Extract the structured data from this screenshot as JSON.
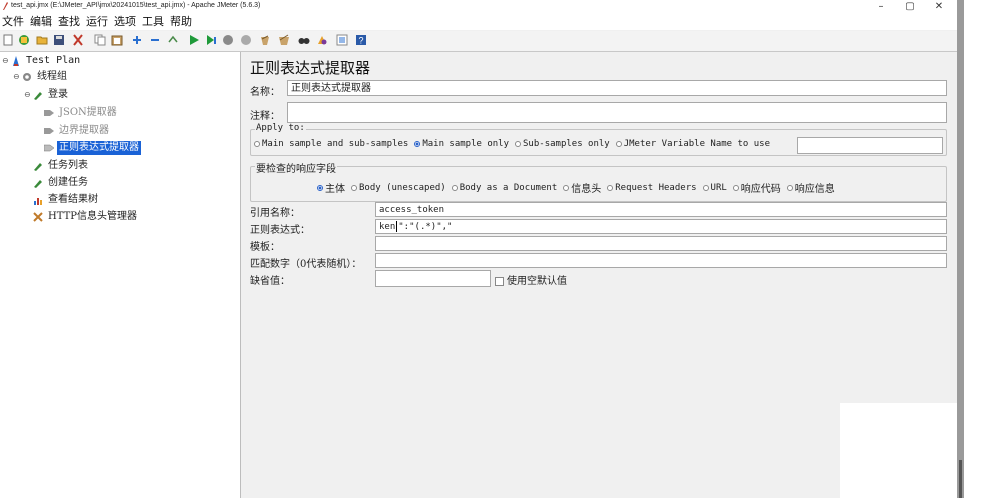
{
  "window": {
    "title": "test_api.jmx (E:\\JMeter_API\\jmx\\20241015\\test_api.jmx) - Apache JMeter (5.6.3)",
    "controls": [
      "–",
      "▢",
      "✕"
    ]
  },
  "menu": [
    "文件",
    "编辑",
    "查找",
    "运行",
    "选项",
    "工具",
    "帮助"
  ],
  "toolbar_icons": [
    "new-icon",
    "templates-icon",
    "open-icon",
    "save-icon",
    "cut-icon",
    "copy-icon",
    "paste-icon",
    "expand-icon",
    "collapse-icon",
    "toggle-icon",
    "start-icon",
    "start-no-pause-icon",
    "stop-icon",
    "shutdown-icon",
    "clear-icon",
    "clear-all-icon",
    "search-icon",
    "reset-search-icon",
    "function-helper-icon",
    "help-icon"
  ],
  "tree": {
    "test_plan": "Test Plan",
    "thread_group": "线程组",
    "login": "登录",
    "json_extractor": "JSON提取器",
    "boundary_extractor": "边界提取器",
    "regex_extractor": "正则表达式提取器",
    "task_list": "任务列表",
    "create_task": "创建任务",
    "view_results": "查看结果树",
    "http_header": "HTTP信息头管理器"
  },
  "panel": {
    "title": "正则表达式提取器",
    "name_label": "名称：",
    "name_value": "正则表达式提取器",
    "comment_label": "注释：",
    "comment_value": "",
    "apply_to": {
      "title": "Apply to:",
      "options": [
        "Main sample and sub-samples",
        "Main sample only",
        "Sub-samples only",
        "JMeter Variable Name to use"
      ],
      "selected": 1
    },
    "field_check": {
      "title": "要检查的响应字段",
      "options": [
        "主体",
        "Body (unescaped)",
        "Body as a Document",
        "信息头",
        "Request Headers",
        "URL",
        "响应代码",
        "响应信息"
      ],
      "selected": 0
    },
    "ref_name_label": "引用名称：",
    "ref_name_value": "access_token",
    "regex_label": "正则表达式：",
    "regex_value_a": "ken",
    "regex_value_b": "\":\"(.*)\",\"",
    "template_label": "模板：",
    "match_no_label": "匹配数字（0代表随机）：",
    "default_label": "缺省值：",
    "use_empty_label": "使用空默认值"
  }
}
